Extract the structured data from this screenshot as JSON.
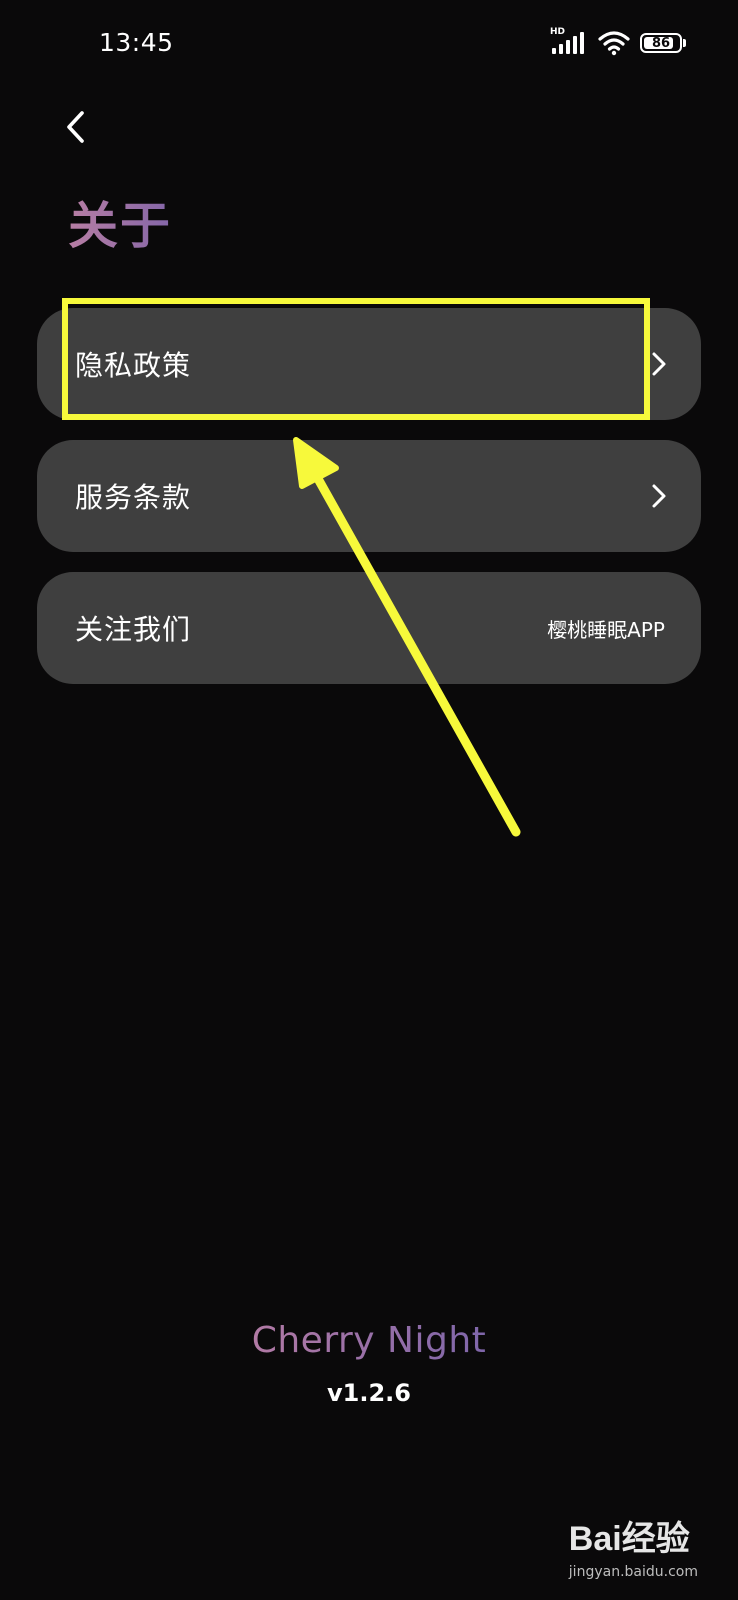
{
  "status_bar": {
    "time": "13:45",
    "network_label": "HD",
    "battery_level": "86",
    "battery_fraction": 0.86
  },
  "header": {
    "back_icon": "chevron-left-icon",
    "title": "关于"
  },
  "menu": {
    "items": [
      {
        "label": "隐私政策",
        "icon": "chevron-right-icon"
      },
      {
        "label": "服务条款",
        "icon": "chevron-right-icon"
      },
      {
        "label": "关注我们",
        "value": "樱桃睡眠APP"
      }
    ]
  },
  "footer": {
    "app_name": "Cherry Night",
    "version": "v1.2.6"
  },
  "watermark": {
    "logo": "Bai经验",
    "url": "jingyan.baidu.com"
  },
  "colors": {
    "background": "#0a090a",
    "card": "#3f3f3f",
    "title_gradient_start": "#b77ea4",
    "title_gradient_end": "#8466a8",
    "annotation": "#f7f93b"
  }
}
